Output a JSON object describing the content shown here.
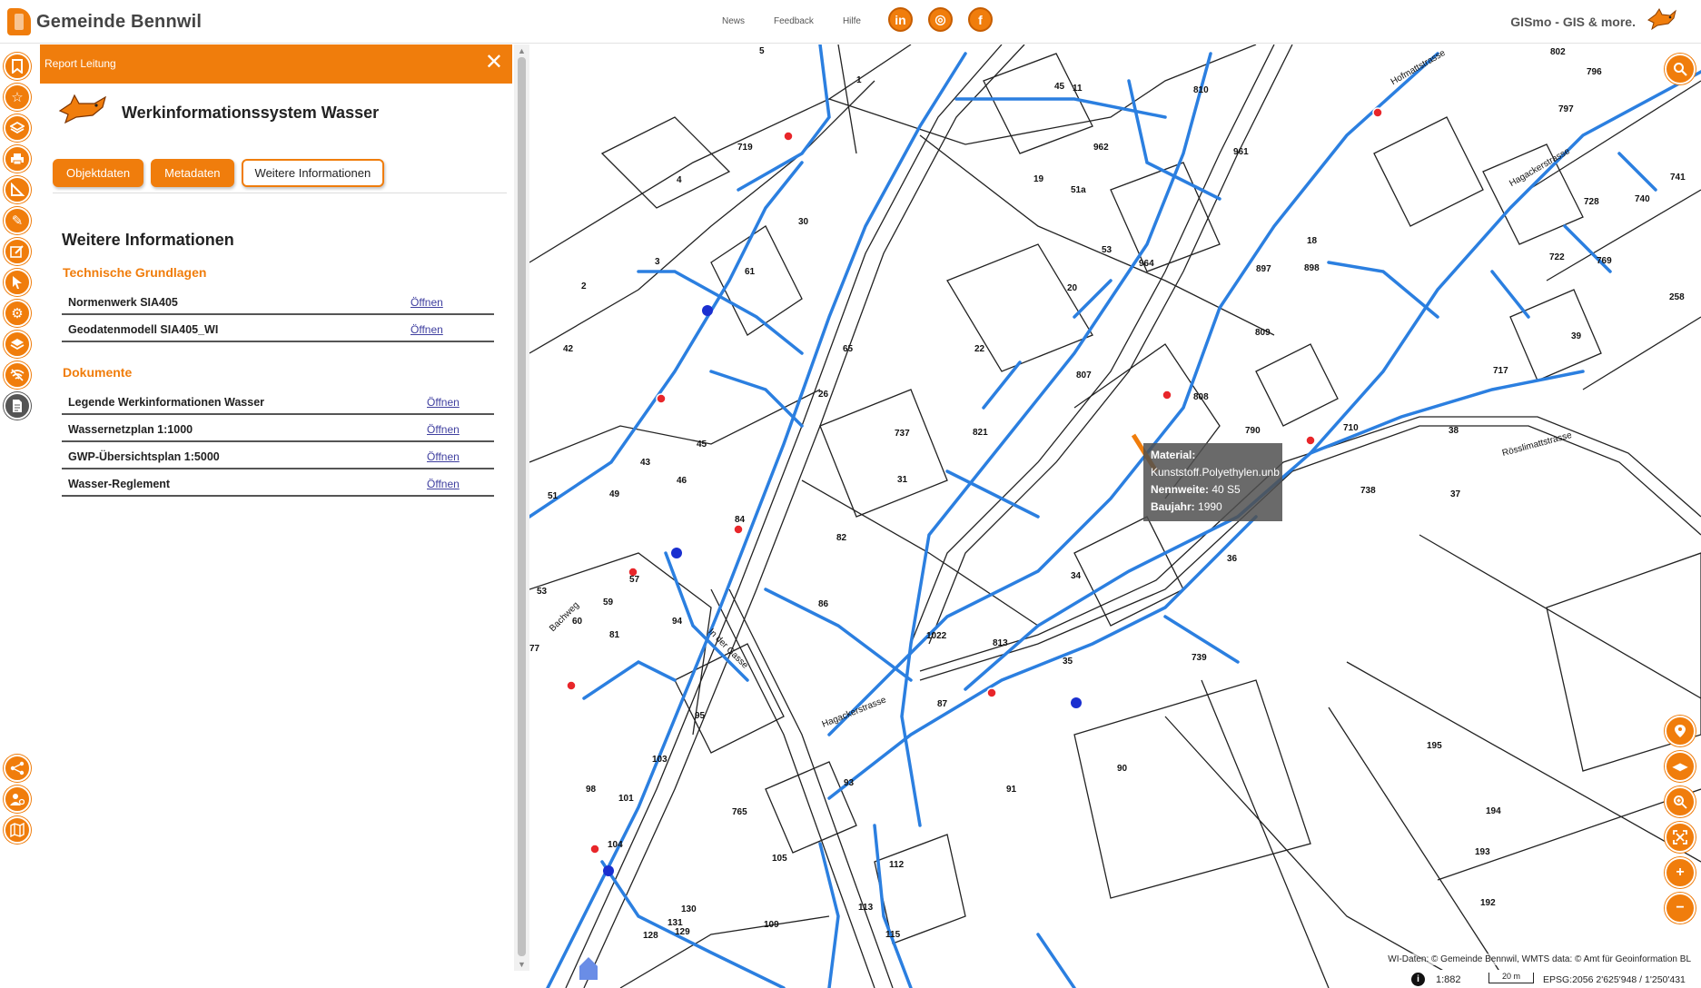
{
  "header": {
    "title": "Gemeinde Bennwil",
    "nav": [
      "News",
      "Feedback",
      "Hilfe"
    ],
    "social": [
      {
        "name": "linkedin-icon",
        "glyph": "in"
      },
      {
        "name": "instagram-icon",
        "glyph": "◎"
      },
      {
        "name": "facebook-icon",
        "glyph": "f"
      }
    ],
    "gismo": "GISmo - GIS & more."
  },
  "colors": {
    "accent": "#f07d0c",
    "pipe": "#2b7fe0",
    "valve_red": "#e8262a",
    "hydrant_blue": "#1a2fd0"
  },
  "left_toolbar": [
    "bookmark-icon",
    "star-icon",
    "layers-icon",
    "print-icon",
    "measure-icon",
    "draw-icon",
    "edit-icon",
    "select-icon",
    "settings-icon",
    "layer-switch-icon",
    "wifi-off-icon",
    "report-icon",
    "share-icon",
    "user-admin-icon",
    "map-icon"
  ],
  "panel": {
    "header": "Report Leitung",
    "app_title": "Werkinformationssystem Wasser",
    "tabs": [
      "Objektdaten",
      "Metadaten",
      "Weitere Informationen"
    ],
    "active_tab": "Weitere Informationen",
    "section_title": "Weitere Informationen",
    "groups": [
      {
        "title": "Technische Grundlagen",
        "rows": [
          {
            "label": "Normenwerk SIA405",
            "link": "Öffnen"
          },
          {
            "label": "Geodatenmodell SIA405_WI",
            "link": "Öffnen"
          }
        ]
      },
      {
        "title": "Dokumente",
        "rows": [
          {
            "label": "Legende Werkinformationen Wasser",
            "link": "Öffnen"
          },
          {
            "label": "Wassernetzplan 1:1000",
            "link": "Öffnen"
          },
          {
            "label": "GWP-Übersichtsplan 1:5000",
            "link": "Öffnen"
          },
          {
            "label": "Wasser-Reglement",
            "link": "Öffnen"
          }
        ]
      }
    ]
  },
  "map": {
    "labels": [
      "5",
      "1",
      "11",
      "45",
      "810",
      "802",
      "796",
      "797",
      "719",
      "4",
      "962",
      "19",
      "51a",
      "961",
      "741",
      "740",
      "728",
      "3",
      "30",
      "53",
      "20",
      "964",
      "897",
      "898",
      "722",
      "769",
      "258",
      "2",
      "42",
      "61",
      "22",
      "18",
      "809",
      "39",
      "65",
      "807",
      "717",
      "808",
      "790",
      "710",
      "38",
      "45",
      "43",
      "46",
      "26",
      "821",
      "31",
      "737",
      "738",
      "37",
      "49",
      "51",
      "84",
      "82",
      "36",
      "34",
      "1022",
      "813",
      "57",
      "53",
      "59",
      "60",
      "81",
      "77",
      "94",
      "86",
      "739",
      "95",
      "87",
      "35",
      "195",
      "194",
      "193",
      "192",
      "98",
      "101",
      "104",
      "103",
      "93",
      "765",
      "105",
      "112",
      "113",
      "115",
      "109",
      "128",
      "129",
      "130",
      "131",
      "91",
      "90"
    ],
    "streets": [
      "Hofmattstrasse",
      "Hagackerstrasse",
      "Rösslimattstrasse",
      "Bachweg",
      "In der Gasse"
    ],
    "tooltip": {
      "material_label": "Material:",
      "material_value": "Kunststoff.Polyethylen.unb",
      "nennweite_label": "Nennweite:",
      "nennweite_value": "40 S5",
      "baujahr_label": "Baujahr:",
      "baujahr_value": "1990"
    },
    "right_tools": [
      "search-icon",
      "locate-icon",
      "swipe-icon",
      "zoom-magnifier-icon",
      "fullscreen-icon",
      "zoom-in-icon",
      "zoom-out-icon"
    ],
    "attribution": "WI-Daten: © Gemeinde Bennwil, WMTS data: © Amt für Geoinformation BL",
    "scale": "1:882",
    "scalebar": "20 m",
    "coords": "EPSG:2056   2'625'948 / 1'250'431"
  }
}
